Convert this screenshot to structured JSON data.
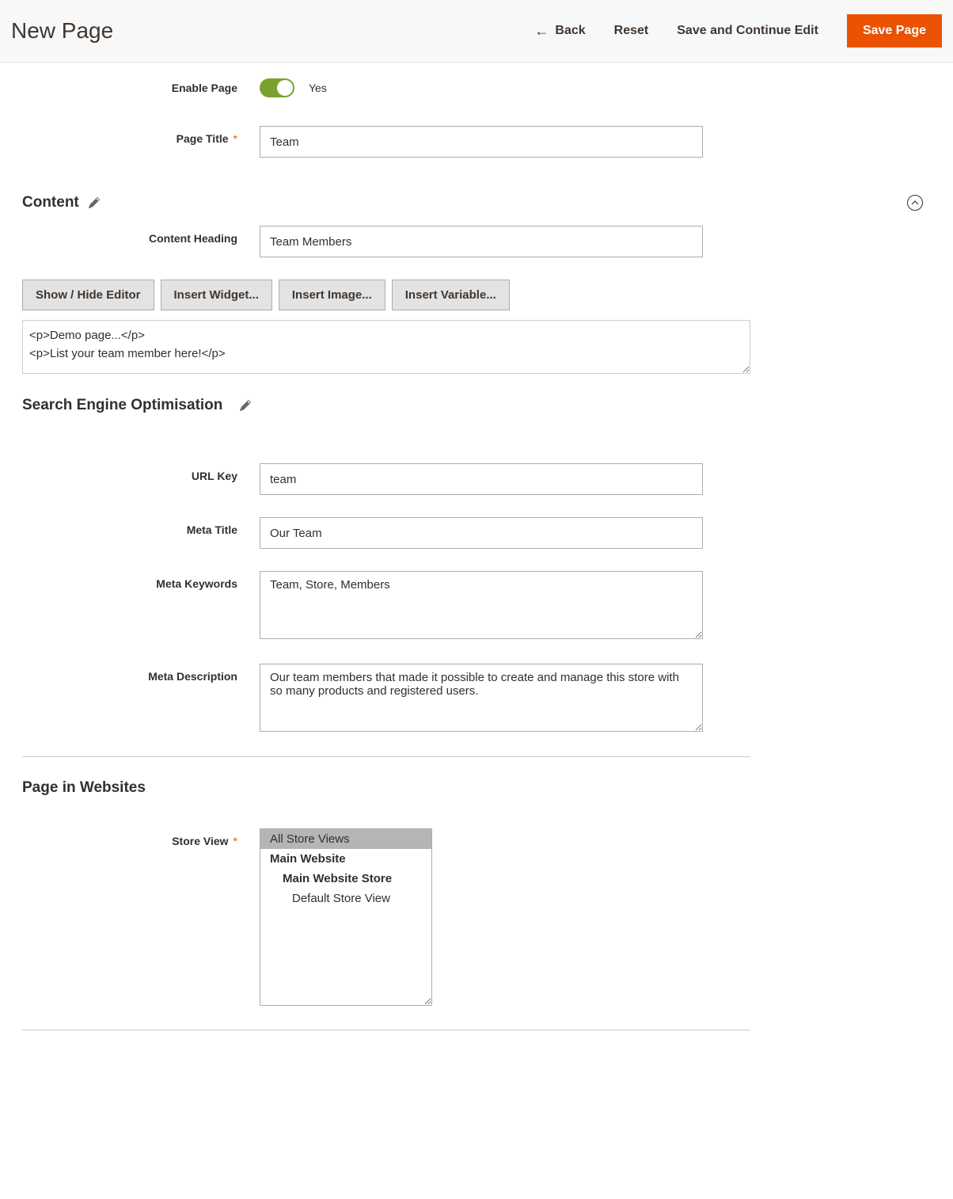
{
  "header": {
    "title": "New Page",
    "back": "Back",
    "reset": "Reset",
    "save_continue": "Save and Continue Edit",
    "save": "Save Page"
  },
  "general": {
    "enable_label": "Enable Page",
    "enable_value": "Yes",
    "page_title_label": "Page Title",
    "page_title_value": "Team"
  },
  "content": {
    "section_title": "Content",
    "heading_label": "Content Heading",
    "heading_value": "Team Members",
    "btn_show_hide": "Show / Hide Editor",
    "btn_widget": "Insert Widget...",
    "btn_image": "Insert Image...",
    "btn_variable": "Insert Variable...",
    "editor_value": "<p>Demo page...</p>\n<p>List your team member here!</p>"
  },
  "seo": {
    "section_title": "Search Engine Optimisation",
    "url_key_label": "URL Key",
    "url_key_value": "team",
    "meta_title_label": "Meta Title",
    "meta_title_value": "Our Team",
    "meta_keywords_label": "Meta Keywords",
    "meta_keywords_value": "Team, Store, Members",
    "meta_description_label": "Meta Description",
    "meta_description_value": "Our team members that made it possible to create and manage this store with so many products and registered users."
  },
  "websites": {
    "section_title": "Page in Websites",
    "store_view_label": "Store View",
    "options": {
      "all": "All Store Views",
      "main_website": "Main Website",
      "main_website_store": "Main Website Store",
      "default_store_view": "Default Store View"
    }
  }
}
